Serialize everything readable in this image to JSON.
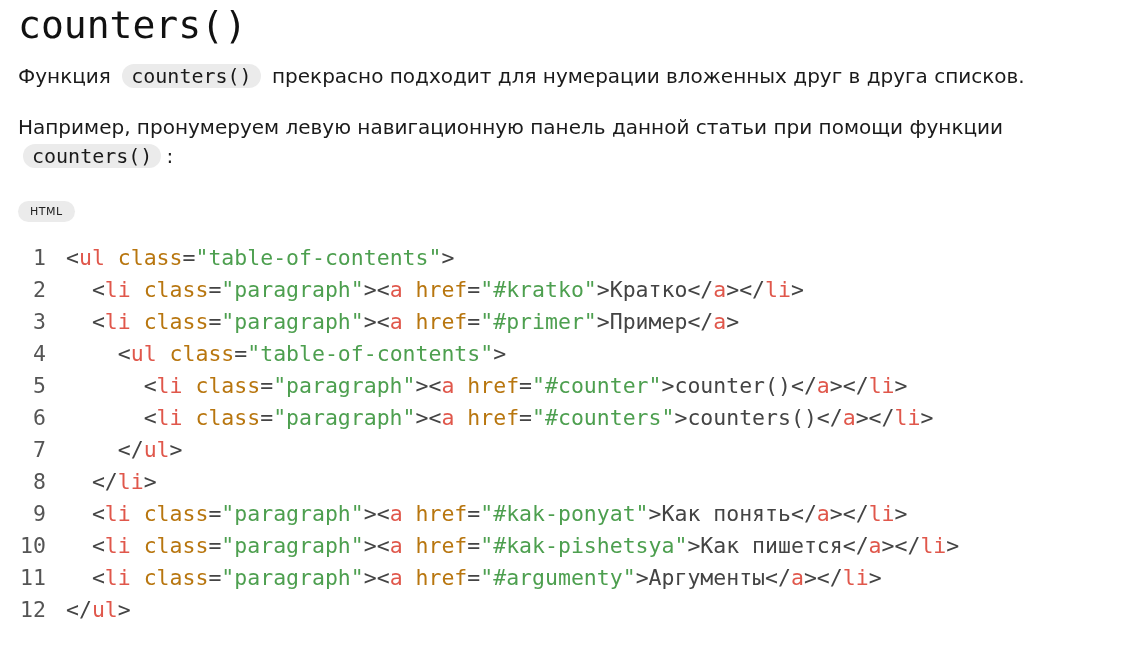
{
  "title": "counters()",
  "paragraphs": [
    {
      "parts": [
        {
          "kind": "text",
          "text": "Функция"
        },
        {
          "kind": "code",
          "text": "counters()"
        },
        {
          "kind": "text",
          "text": "прекрасно подходит для нумерации вложенных друг в друга списков."
        }
      ]
    },
    {
      "parts": [
        {
          "kind": "text",
          "text": "Например, пронумеруем левую навигационную панель данной статьи при помощи функции"
        },
        {
          "kind": "code",
          "text": "counters()"
        },
        {
          "kind": "text",
          "text": ":"
        }
      ]
    }
  ],
  "code_block": {
    "language": "HTML",
    "lines": [
      {
        "number": "1",
        "tokens": [
          {
            "kind": "punct",
            "text": "<"
          },
          {
            "kind": "tag",
            "text": "ul"
          },
          {
            "kind": "attr",
            "text": " class"
          },
          {
            "kind": "punct",
            "text": "="
          },
          {
            "kind": "string",
            "text": "\"table-of-contents\""
          },
          {
            "kind": "punct",
            "text": ">"
          }
        ]
      },
      {
        "number": "2",
        "tokens": [
          {
            "kind": "punct",
            "text": "  <"
          },
          {
            "kind": "tag",
            "text": "li"
          },
          {
            "kind": "attr",
            "text": " class"
          },
          {
            "kind": "punct",
            "text": "="
          },
          {
            "kind": "string",
            "text": "\"paragraph\""
          },
          {
            "kind": "punct",
            "text": "><"
          },
          {
            "kind": "tag",
            "text": "a"
          },
          {
            "kind": "attr",
            "text": " href"
          },
          {
            "kind": "punct",
            "text": "="
          },
          {
            "kind": "string",
            "text": "\"#kratko\""
          },
          {
            "kind": "punct",
            "text": ">Кратко</"
          },
          {
            "kind": "tag",
            "text": "a"
          },
          {
            "kind": "punct",
            "text": "></"
          },
          {
            "kind": "tag",
            "text": "li"
          },
          {
            "kind": "punct",
            "text": ">"
          }
        ]
      },
      {
        "number": "3",
        "tokens": [
          {
            "kind": "punct",
            "text": "  <"
          },
          {
            "kind": "tag",
            "text": "li"
          },
          {
            "kind": "attr",
            "text": " class"
          },
          {
            "kind": "punct",
            "text": "="
          },
          {
            "kind": "string",
            "text": "\"paragraph\""
          },
          {
            "kind": "punct",
            "text": "><"
          },
          {
            "kind": "tag",
            "text": "a"
          },
          {
            "kind": "attr",
            "text": " href"
          },
          {
            "kind": "punct",
            "text": "="
          },
          {
            "kind": "string",
            "text": "\"#primer\""
          },
          {
            "kind": "punct",
            "text": ">Пример</"
          },
          {
            "kind": "tag",
            "text": "a"
          },
          {
            "kind": "punct",
            "text": ">"
          }
        ]
      },
      {
        "number": "4",
        "tokens": [
          {
            "kind": "punct",
            "text": "    <"
          },
          {
            "kind": "tag",
            "text": "ul"
          },
          {
            "kind": "attr",
            "text": " class"
          },
          {
            "kind": "punct",
            "text": "="
          },
          {
            "kind": "string",
            "text": "\"table-of-contents\""
          },
          {
            "kind": "punct",
            "text": ">"
          }
        ]
      },
      {
        "number": "5",
        "tokens": [
          {
            "kind": "punct",
            "text": "      <"
          },
          {
            "kind": "tag",
            "text": "li"
          },
          {
            "kind": "attr",
            "text": " class"
          },
          {
            "kind": "punct",
            "text": "="
          },
          {
            "kind": "string",
            "text": "\"paragraph\""
          },
          {
            "kind": "punct",
            "text": "><"
          },
          {
            "kind": "tag",
            "text": "a"
          },
          {
            "kind": "attr",
            "text": " href"
          },
          {
            "kind": "punct",
            "text": "="
          },
          {
            "kind": "string",
            "text": "\"#counter\""
          },
          {
            "kind": "punct",
            "text": ">counter()</"
          },
          {
            "kind": "tag",
            "text": "a"
          },
          {
            "kind": "punct",
            "text": "></"
          },
          {
            "kind": "tag",
            "text": "li"
          },
          {
            "kind": "punct",
            "text": ">"
          }
        ]
      },
      {
        "number": "6",
        "tokens": [
          {
            "kind": "punct",
            "text": "      <"
          },
          {
            "kind": "tag",
            "text": "li"
          },
          {
            "kind": "attr",
            "text": " class"
          },
          {
            "kind": "punct",
            "text": "="
          },
          {
            "kind": "string",
            "text": "\"paragraph\""
          },
          {
            "kind": "punct",
            "text": "><"
          },
          {
            "kind": "tag",
            "text": "a"
          },
          {
            "kind": "attr",
            "text": " href"
          },
          {
            "kind": "punct",
            "text": "="
          },
          {
            "kind": "string",
            "text": "\"#counters\""
          },
          {
            "kind": "punct",
            "text": ">counters()</"
          },
          {
            "kind": "tag",
            "text": "a"
          },
          {
            "kind": "punct",
            "text": "></"
          },
          {
            "kind": "tag",
            "text": "li"
          },
          {
            "kind": "punct",
            "text": ">"
          }
        ]
      },
      {
        "number": "7",
        "tokens": [
          {
            "kind": "punct",
            "text": "    </"
          },
          {
            "kind": "tag",
            "text": "ul"
          },
          {
            "kind": "punct",
            "text": ">"
          }
        ]
      },
      {
        "number": "8",
        "tokens": [
          {
            "kind": "punct",
            "text": "  </"
          },
          {
            "kind": "tag",
            "text": "li"
          },
          {
            "kind": "punct",
            "text": ">"
          }
        ]
      },
      {
        "number": "9",
        "tokens": [
          {
            "kind": "punct",
            "text": "  <"
          },
          {
            "kind": "tag",
            "text": "li"
          },
          {
            "kind": "attr",
            "text": " class"
          },
          {
            "kind": "punct",
            "text": "="
          },
          {
            "kind": "string",
            "text": "\"paragraph\""
          },
          {
            "kind": "punct",
            "text": "><"
          },
          {
            "kind": "tag",
            "text": "a"
          },
          {
            "kind": "attr",
            "text": " href"
          },
          {
            "kind": "punct",
            "text": "="
          },
          {
            "kind": "string",
            "text": "\"#kak-ponyat\""
          },
          {
            "kind": "punct",
            "text": ">Как понять</"
          },
          {
            "kind": "tag",
            "text": "a"
          },
          {
            "kind": "punct",
            "text": "></"
          },
          {
            "kind": "tag",
            "text": "li"
          },
          {
            "kind": "punct",
            "text": ">"
          }
        ]
      },
      {
        "number": "10",
        "tokens": [
          {
            "kind": "punct",
            "text": "  <"
          },
          {
            "kind": "tag",
            "text": "li"
          },
          {
            "kind": "attr",
            "text": " class"
          },
          {
            "kind": "punct",
            "text": "="
          },
          {
            "kind": "string",
            "text": "\"paragraph\""
          },
          {
            "kind": "punct",
            "text": "><"
          },
          {
            "kind": "tag",
            "text": "a"
          },
          {
            "kind": "attr",
            "text": " href"
          },
          {
            "kind": "punct",
            "text": "="
          },
          {
            "kind": "string",
            "text": "\"#kak-pishetsya\""
          },
          {
            "kind": "punct",
            "text": ">Как пишется</"
          },
          {
            "kind": "tag",
            "text": "a"
          },
          {
            "kind": "punct",
            "text": "></"
          },
          {
            "kind": "tag",
            "text": "li"
          },
          {
            "kind": "punct",
            "text": ">"
          }
        ]
      },
      {
        "number": "11",
        "tokens": [
          {
            "kind": "punct",
            "text": "  <"
          },
          {
            "kind": "tag",
            "text": "li"
          },
          {
            "kind": "attr",
            "text": " class"
          },
          {
            "kind": "punct",
            "text": "="
          },
          {
            "kind": "string",
            "text": "\"paragraph\""
          },
          {
            "kind": "punct",
            "text": "><"
          },
          {
            "kind": "tag",
            "text": "a"
          },
          {
            "kind": "attr",
            "text": " href"
          },
          {
            "kind": "punct",
            "text": "="
          },
          {
            "kind": "string",
            "text": "\"#argumenty\""
          },
          {
            "kind": "punct",
            "text": ">Аргументы</"
          },
          {
            "kind": "tag",
            "text": "a"
          },
          {
            "kind": "punct",
            "text": "></"
          },
          {
            "kind": "tag",
            "text": "li"
          },
          {
            "kind": "punct",
            "text": ">"
          }
        ]
      },
      {
        "number": "12",
        "tokens": [
          {
            "kind": "punct",
            "text": "</"
          },
          {
            "kind": "tag",
            "text": "ul"
          },
          {
            "kind": "punct",
            "text": ">"
          }
        ]
      }
    ]
  }
}
